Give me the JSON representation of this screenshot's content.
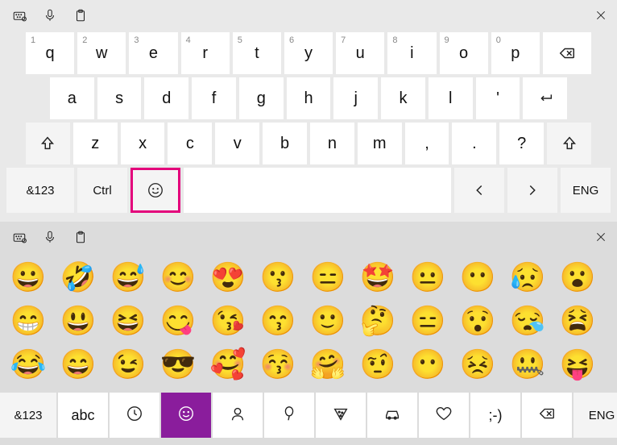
{
  "alpha": {
    "row1": [
      {
        "sup": "1",
        "label": "q"
      },
      {
        "sup": "2",
        "label": "w"
      },
      {
        "sup": "3",
        "label": "e"
      },
      {
        "sup": "4",
        "label": "r"
      },
      {
        "sup": "5",
        "label": "t"
      },
      {
        "sup": "6",
        "label": "y"
      },
      {
        "sup": "7",
        "label": "u"
      },
      {
        "sup": "8",
        "label": "i"
      },
      {
        "sup": "9",
        "label": "o"
      },
      {
        "sup": "0",
        "label": "p"
      }
    ],
    "row2": [
      "a",
      "s",
      "d",
      "f",
      "g",
      "h",
      "j",
      "k",
      "l",
      "'"
    ],
    "row3": [
      "z",
      "x",
      "c",
      "v",
      "b",
      "n",
      "m",
      ",",
      ".",
      "?"
    ],
    "fn": {
      "numsym": "&123",
      "ctrl": "Ctrl",
      "lang": "ENG"
    }
  },
  "emoji": {
    "grid": [
      [
        "😀",
        "🤣",
        "😅",
        "😊",
        "😍",
        "😗",
        "😑",
        "🤩",
        "😐",
        "😶",
        "😥",
        "😮"
      ],
      [
        "😁",
        "😃",
        "😆",
        "😋",
        "😘",
        "😙",
        "🙂",
        "🤔",
        "😑",
        "😯",
        "😪",
        "😫"
      ],
      [
        "😂",
        "😄",
        "😉",
        "😎",
        "🥰",
        "😚",
        "🤗",
        "🤨",
        "😶",
        "😣",
        "🤐",
        "😝"
      ]
    ],
    "bar": {
      "numsym": "&123",
      "abc": "abc",
      "kaomoji": ";-)",
      "lang": "ENG"
    }
  }
}
